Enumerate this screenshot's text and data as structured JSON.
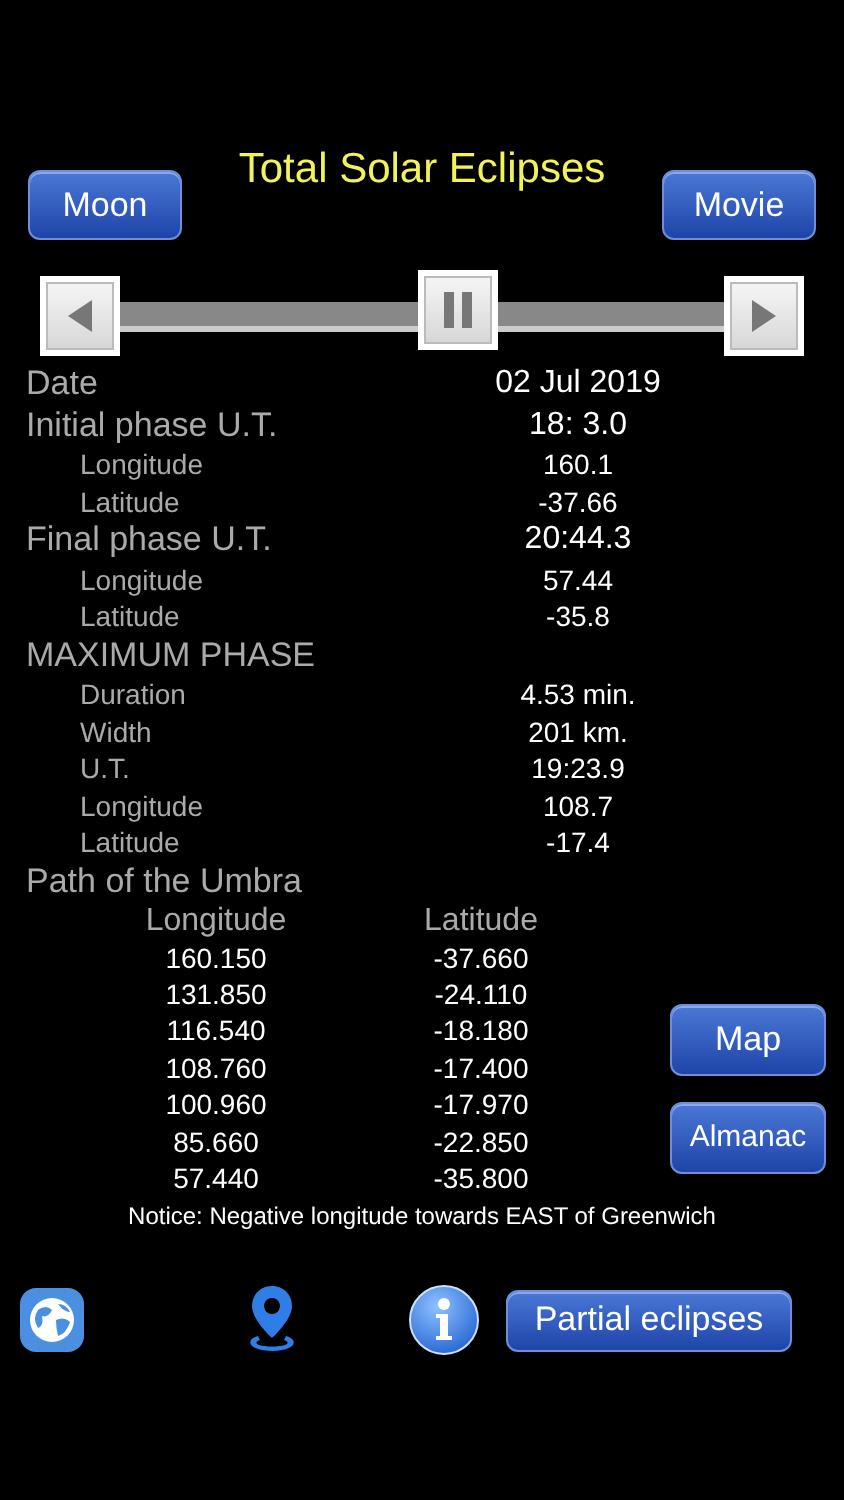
{
  "title": "Total Solar Eclipses",
  "top_buttons": [
    {
      "label": "Moon"
    },
    {
      "label": "Movie"
    }
  ],
  "timeline": {
    "level": 0.56
  },
  "details": [
    {
      "kind": "heading",
      "label": "Date",
      "value": "02 Jul 2019"
    },
    {
      "kind": "heading",
      "label": "Initial phase U.T.",
      "value": "18: 3.0"
    },
    {
      "kind": "sub",
      "label": "Longitude",
      "value": "160.1"
    },
    {
      "kind": "sub",
      "label": "Latitude",
      "value": "-37.66"
    },
    {
      "kind": "heading",
      "label": "Final phase U.T.",
      "value": "20:44.3"
    },
    {
      "kind": "sub",
      "label": "Longitude",
      "value": "57.44"
    },
    {
      "kind": "sub",
      "label": "Latitude",
      "value": "-35.8"
    },
    {
      "kind": "heading",
      "label": "MAXIMUM PHASE"
    },
    {
      "kind": "sub",
      "label": "Duration",
      "value": "4.53 min."
    },
    {
      "kind": "sub",
      "label": "Width",
      "value": "201 km."
    },
    {
      "kind": "sub",
      "label": "U.T.",
      "value": "19:23.9"
    },
    {
      "kind": "sub",
      "label": "Longitude",
      "value": "108.7"
    },
    {
      "kind": "sub",
      "label": "Latitude",
      "value": "-17.4"
    }
  ],
  "umbra": {
    "title": "Path of the Umbra",
    "columns": [
      "Longitude",
      "Latitude"
    ],
    "rows": [
      [
        "160.150",
        "-37.660"
      ],
      [
        "131.850",
        "-24.110"
      ],
      [
        "116.540",
        "-18.180"
      ],
      [
        "108.760",
        "-17.400"
      ],
      [
        "100.960",
        "-17.970"
      ],
      [
        "85.660",
        "-22.850"
      ],
      [
        "57.440",
        "-35.800"
      ]
    ]
  },
  "side_buttons": [
    {
      "label": "Map"
    },
    {
      "label": "Almanac"
    }
  ],
  "notice": "Notice: Negative longitude towards EAST of Greenwich",
  "bottom_button": {
    "label": "Partial eclipses"
  }
}
